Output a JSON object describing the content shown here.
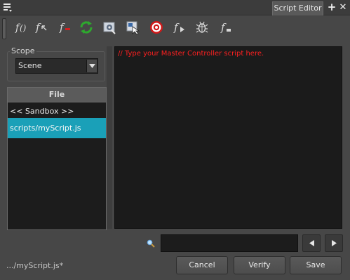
{
  "tab": {
    "title": "Script Editor",
    "add_icon": "plus-icon",
    "close_icon": "close-icon"
  },
  "toolbar": {
    "items": [
      {
        "icon": "script-function-icon"
      },
      {
        "icon": "function-import-icon"
      },
      {
        "icon": "function-delete-icon"
      },
      {
        "icon": "refresh-icon"
      },
      {
        "icon": "settings-icon"
      },
      {
        "icon": "target-picker-icon"
      },
      {
        "icon": "target-icon"
      },
      {
        "icon": "function-run-icon"
      },
      {
        "icon": "debug-bug-icon"
      },
      {
        "icon": "function-new-icon"
      }
    ]
  },
  "scope": {
    "label": "Scope",
    "value": "Scene"
  },
  "file_list": {
    "header": "File",
    "items": [
      {
        "label": "<< Sandbox >>",
        "selected": false
      },
      {
        "label": "scripts/myScript.js",
        "selected": true
      }
    ]
  },
  "editor": {
    "placeholder_comment": "// Type your Master Controller script here."
  },
  "search": {
    "value": ""
  },
  "status": {
    "filename": ".../myScript.js*"
  },
  "buttons": {
    "cancel": "Cancel",
    "verify": "Verify",
    "save": "Save"
  },
  "colors": {
    "selection": "#1aa0b8",
    "comment": "#ff2020",
    "background": "#474747"
  }
}
